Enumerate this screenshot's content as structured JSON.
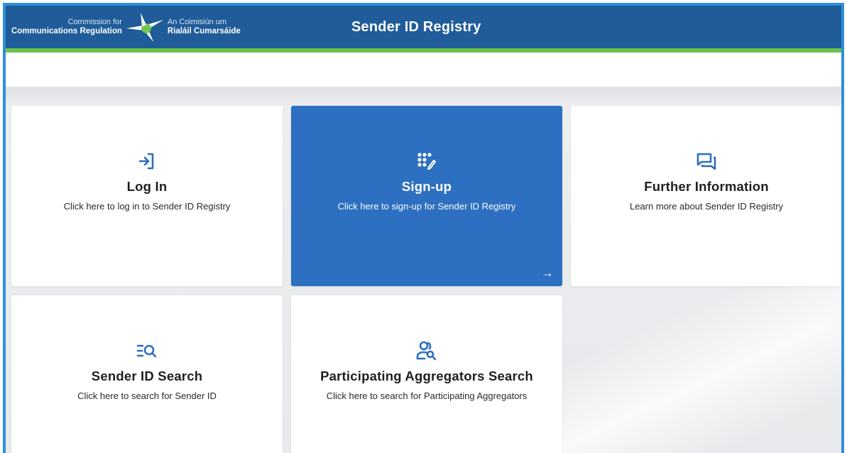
{
  "header": {
    "logo": {
      "left_line1": "Commission for",
      "left_line2": "Communications Regulation",
      "right_line1": "An Coimisiún um",
      "right_line2": "Rialáil Cumarsáide"
    },
    "title": "Sender ID Registry"
  },
  "colors": {
    "header_blue": "#1f5c99",
    "accent_green": "#6cc24a",
    "active_tile": "#2d6fc0",
    "icon_blue": "#2d6fc0"
  },
  "tiles": [
    {
      "icon": "login-icon",
      "title": "Log In",
      "description": "Click here to log in to Sender ID Registry"
    },
    {
      "icon": "keypad-edit-icon",
      "title": "Sign-up",
      "description": "Click here to sign-up for Sender ID Registry",
      "active": true,
      "arrow": "→"
    },
    {
      "icon": "chat-bubbles-icon",
      "title": "Further Information",
      "description": "Learn more about Sender ID Registry"
    },
    {
      "icon": "list-search-icon",
      "title": "Sender ID Search",
      "description": "Click here to search for Sender ID"
    },
    {
      "icon": "user-search-icon",
      "title": "Participating Aggregators Search",
      "description": "Click here to search for Participating Aggregators"
    }
  ]
}
